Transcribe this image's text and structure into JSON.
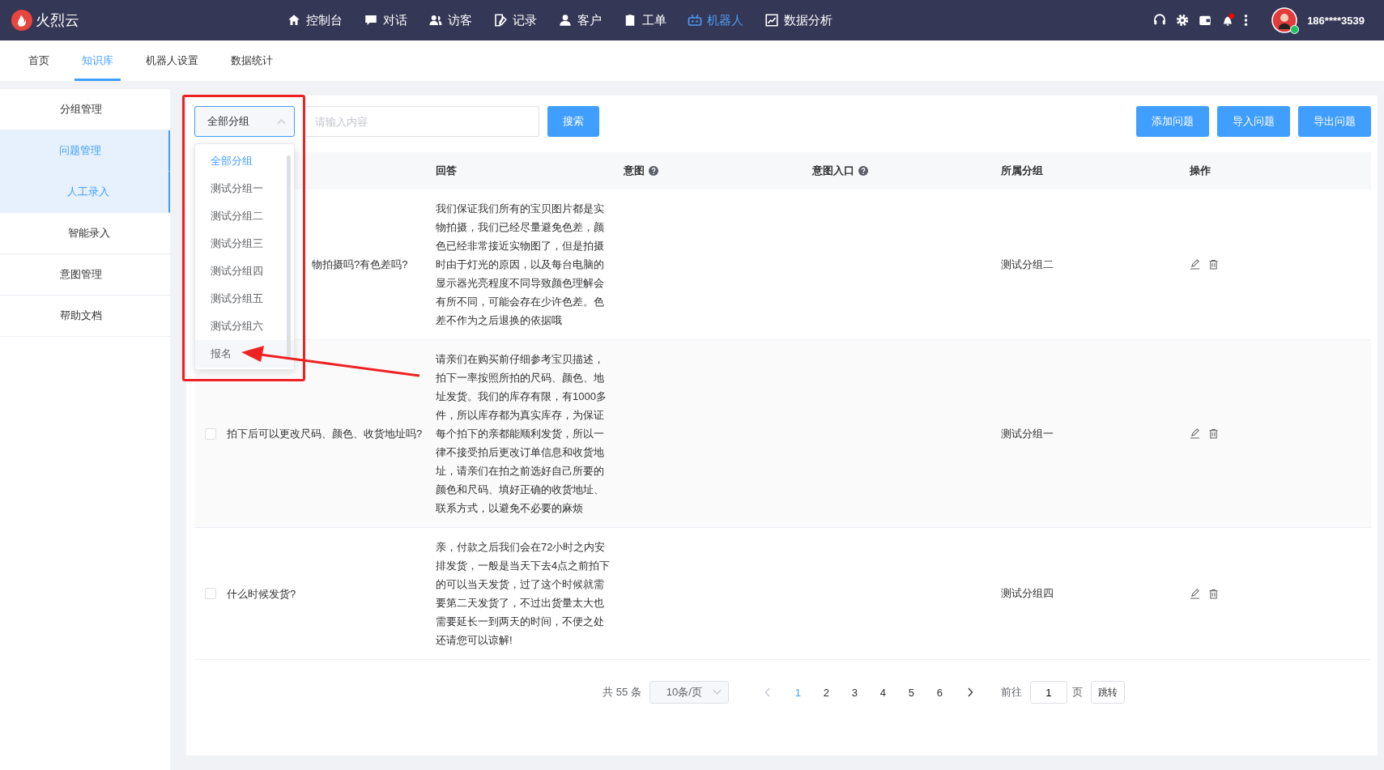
{
  "brand": "火烈云",
  "nav": [
    {
      "label": "控制台",
      "selected": false
    },
    {
      "label": "对话",
      "selected": false
    },
    {
      "label": "访客",
      "selected": false
    },
    {
      "label": "记录",
      "selected": false
    },
    {
      "label": "客户",
      "selected": false
    },
    {
      "label": "工单",
      "selected": false
    },
    {
      "label": "机器人",
      "selected": true
    },
    {
      "label": "数据分析",
      "selected": false
    }
  ],
  "user": {
    "name": "186****3539",
    "online": true,
    "notification": true
  },
  "tabs": [
    {
      "label": "首页",
      "selected": false
    },
    {
      "label": "知识库",
      "selected": true
    },
    {
      "label": "机器人设置",
      "selected": false
    },
    {
      "label": "数据统计",
      "selected": false
    }
  ],
  "sidebar": {
    "items": [
      {
        "label": "分组管理",
        "selected": false
      },
      {
        "label": "问题管理",
        "selected": true,
        "children": [
          {
            "label": "人工录入",
            "selected": true
          },
          {
            "label": "智能录入",
            "selected": false
          }
        ]
      },
      {
        "label": "意图管理",
        "selected": false
      },
      {
        "label": "帮助文档",
        "selected": false
      }
    ]
  },
  "toolbar": {
    "group_select": {
      "value": "全部分组",
      "expanded": true
    },
    "search": {
      "placeholder": "请输入内容"
    },
    "search_button": "搜索",
    "buttons": [
      "添加问题",
      "导入问题",
      "导出问题"
    ]
  },
  "dropdown": {
    "options": [
      {
        "label": "全部分组",
        "selected": true
      },
      {
        "label": "测试分组一",
        "selected": false
      },
      {
        "label": "测试分组二",
        "selected": false
      },
      {
        "label": "测试分组三",
        "selected": false
      },
      {
        "label": "测试分组四",
        "selected": false
      },
      {
        "label": "测试分组五",
        "selected": false
      },
      {
        "label": "测试分组六",
        "selected": false
      },
      {
        "label": "报名",
        "selected": false
      }
    ]
  },
  "table": {
    "columns": [
      {
        "label": "回答",
        "help": false
      },
      {
        "label": "意图",
        "help": true
      },
      {
        "label": "意图入口",
        "help": true
      },
      {
        "label": "所属分组",
        "help": false
      },
      {
        "label": "操作",
        "help": false
      }
    ],
    "rows": [
      {
        "question": "物拍摄吗?有色差吗?",
        "answer": "我们保证我们所有的宝贝图片都是实物拍摄，我们已经尽量避免色差，颜色已经非常接近实物图了，但是拍摄时由于灯光的原因，以及每台电脑的显示器光亮程度不同导致颜色理解会有所不同，可能会存在少许色差。色差不作为之后退换的依据哦",
        "group": "测试分组二"
      },
      {
        "checked": false,
        "question": "拍下后可以更改尺码、颜色、收货地址吗?",
        "answer": "请亲们在购买前仔细参考宝贝描述，拍下一率按照所拍的尺码、颜色、地址发货。我们的库存有限，有1000多件，所以库存都为真实库存，为保证每个拍下的亲都能顺利发货，所以一律不接受拍后更改订单信息和收货地址，请亲们在拍之前选好自己所要的颜色和尺码、填好正确的收货地址、联系方式，以避免不必要的麻烦",
        "group": "测试分组一"
      },
      {
        "checked": false,
        "question": "什么时候发货?",
        "answer": "亲，付款之后我们会在72小时之内安排发货，一般是当天下去4点之前拍下的可以当天发货，过了这个时候就需要第二天发货了，不过出货量太大也需要延长一到两天的时间，不便之处还请您可以谅解!",
        "group": "测试分组四"
      }
    ]
  },
  "pagination": {
    "total": "共 55 条",
    "page_size": "10条/页",
    "pages": [
      {
        "label": "1",
        "selected": true
      },
      {
        "label": "2",
        "selected": false
      },
      {
        "label": "3",
        "selected": false
      },
      {
        "label": "4",
        "selected": false
      },
      {
        "label": "5",
        "selected": false
      },
      {
        "label": "6",
        "selected": false
      }
    ],
    "goto_label": "前往",
    "goto_value": "1",
    "page_unit": "页",
    "jump_button": "跳转"
  }
}
